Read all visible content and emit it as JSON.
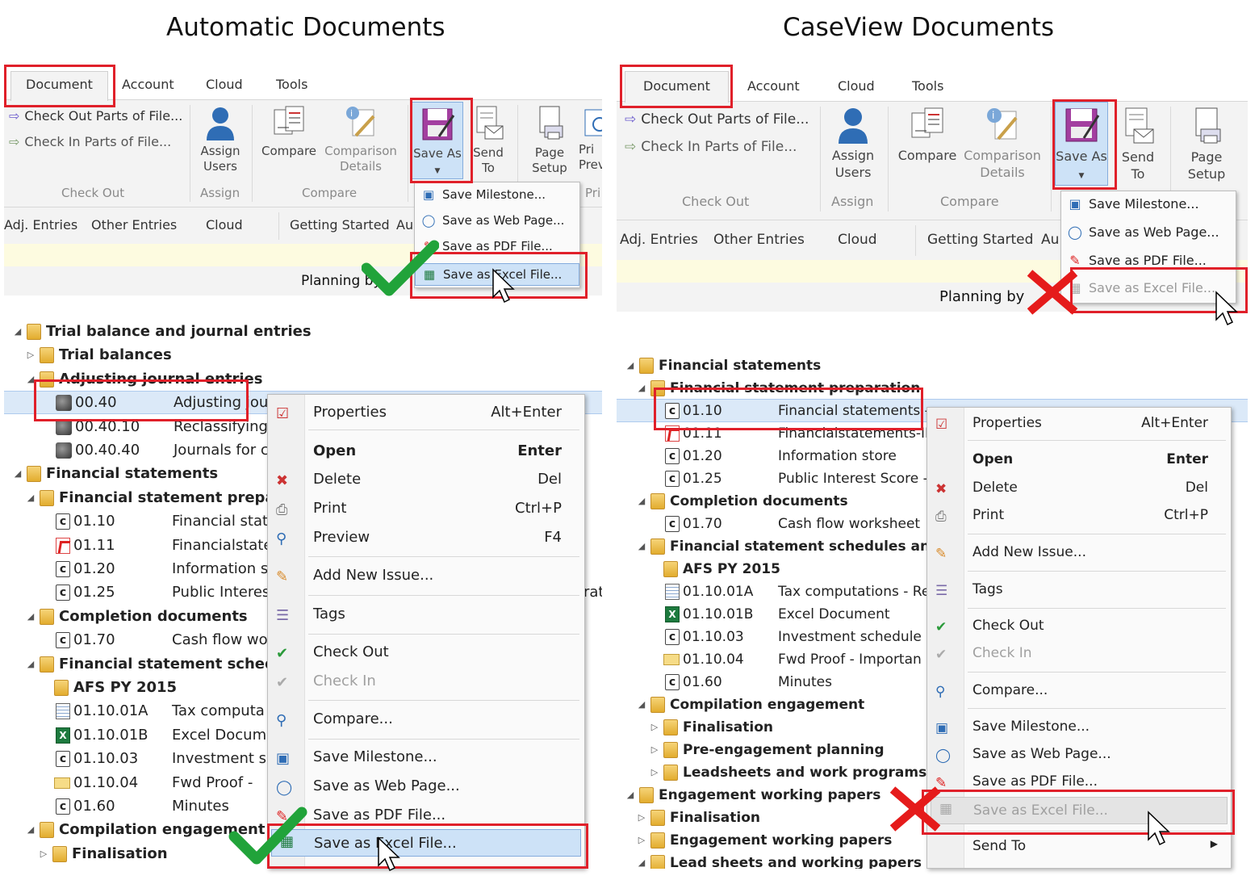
{
  "headings": {
    "left": "Automatic Documents",
    "right": "CaseView Documents"
  },
  "ribbon": {
    "tabs": [
      "Document",
      "Account",
      "Cloud",
      "Tools"
    ],
    "check_out_parts": "Check Out Parts of File...",
    "check_in_parts": "Check In Parts of File...",
    "assign_users": "Assign Users",
    "compare": "Compare",
    "comparison_details": "Comparison Details",
    "save_as": "Save As",
    "send_to": "Send To",
    "page_setup": "Page Setup",
    "print_preview_left": "Pri Prev",
    "group_check_out": "Check Out",
    "group_assign": "Assign",
    "group_compare": "Compare",
    "group_print_partial": "Pri",
    "sub_tabs": [
      "Adj. Entries",
      "Other Entries",
      "Cloud",
      "Getting Started",
      "Au"
    ],
    "planning_by": "Planning by"
  },
  "save_menu": {
    "items": [
      "Save Milestone...",
      "Save as Web Page...",
      "Save as PDF File...",
      "Save as Excel File..."
    ]
  },
  "context_menu": {
    "items": [
      {
        "label": "Properties",
        "shortcut": "Alt+Enter"
      },
      {
        "label": "Open",
        "shortcut": "Enter"
      },
      {
        "label": "Delete",
        "shortcut": "Del"
      },
      {
        "label": "Print",
        "shortcut": "Ctrl+P"
      },
      {
        "label": "Preview",
        "shortcut": "F4"
      },
      {
        "label": "Add New Issue...",
        "shortcut": ""
      },
      {
        "label": "Tags",
        "shortcut": ""
      },
      {
        "label": "Check Out",
        "shortcut": ""
      },
      {
        "label": "Check In",
        "shortcut": ""
      },
      {
        "label": "Compare...",
        "shortcut": ""
      },
      {
        "label": "Save Milestone...",
        "shortcut": ""
      },
      {
        "label": "Save as Web Page...",
        "shortcut": ""
      },
      {
        "label": "Save as PDF File...",
        "shortcut": ""
      },
      {
        "label": "Save as Excel File...",
        "shortcut": ""
      },
      {
        "label": "Send To",
        "shortcut": ""
      }
    ]
  },
  "left_tree": [
    {
      "type": "folder",
      "label": "Trial balance and journal entries"
    },
    {
      "type": "folder",
      "label": "Trial balances"
    },
    {
      "type": "folder",
      "label": "Adjusting journal entries"
    },
    {
      "code": "00.40",
      "name": "Adjusting jou"
    },
    {
      "code": "00.40.10",
      "name": "Reclassifying"
    },
    {
      "code": "00.40.40",
      "name": "Journals for c"
    },
    {
      "type": "folder",
      "label": "Financial statements"
    },
    {
      "type": "folder",
      "label": "Financial statement prepara"
    },
    {
      "code": "01.10",
      "name": "Financial stat"
    },
    {
      "code": "01.11",
      "name": "Financialstate"
    },
    {
      "code": "01.20",
      "name": "Information s"
    },
    {
      "code": "01.25",
      "name": "Public Interes"
    },
    {
      "type": "folder",
      "label": "Completion documents"
    },
    {
      "code": "01.70",
      "name": "Cash flow wo"
    },
    {
      "type": "folder",
      "label": "Financial statement schedul"
    },
    {
      "type": "folder",
      "label": "AFS PY 2015"
    },
    {
      "code": "01.10.01A",
      "name": "Tax computa"
    },
    {
      "code": "01.10.01B",
      "name": "Excel Docum"
    },
    {
      "code": "01.10.03",
      "name": "Investment s"
    },
    {
      "code": "01.10.04",
      "name": "Fwd  Proof -"
    },
    {
      "code": "01.60",
      "name": "Minutes"
    },
    {
      "type": "folder",
      "label": "Compilation engagement"
    },
    {
      "type": "folder",
      "label": "Finalisation"
    }
  ],
  "left_tree_overflow": "rat",
  "right_tree": [
    {
      "type": "folder",
      "label": "Financial statements"
    },
    {
      "type": "folder",
      "label": "Financial statement preparation"
    },
    {
      "code": "01.10",
      "name": "Financial statements -"
    },
    {
      "code": "01.11",
      "name": "Financialstatements-IF"
    },
    {
      "code": "01.20",
      "name": "Information store"
    },
    {
      "code": "01.25",
      "name": "Public Interest Score -"
    },
    {
      "type": "folder",
      "label": "Completion documents"
    },
    {
      "code": "01.70",
      "name": "Cash flow worksheet"
    },
    {
      "type": "folder",
      "label": "Financial statement schedules and m"
    },
    {
      "type": "folder",
      "label": "AFS PY 2015"
    },
    {
      "code": "01.10.01A",
      "name": "Tax computations - Re"
    },
    {
      "code": "01.10.01B",
      "name": "Excel Document"
    },
    {
      "code": "01.10.03",
      "name": "Investment schedule"
    },
    {
      "code": "01.10.04",
      "name": "Fwd  Proof - Importan"
    },
    {
      "code": "01.60",
      "name": "Minutes"
    },
    {
      "type": "folder",
      "label": "Compilation engagement"
    },
    {
      "type": "folder",
      "label": "Finalisation"
    },
    {
      "type": "folder",
      "label": "Pre-engagement planning"
    },
    {
      "type": "folder",
      "label": "Leadsheets and work programs"
    },
    {
      "type": "folder",
      "label": "Engagement working papers"
    },
    {
      "type": "folder",
      "label": "Finalisation"
    },
    {
      "type": "folder",
      "label": "Engagement working papers"
    },
    {
      "type": "folder",
      "label": "Lead sheets and working papers"
    }
  ],
  "colors": {
    "highlight": "#e0202a",
    "check": "#21a33a",
    "cross": "#e51b1b"
  }
}
